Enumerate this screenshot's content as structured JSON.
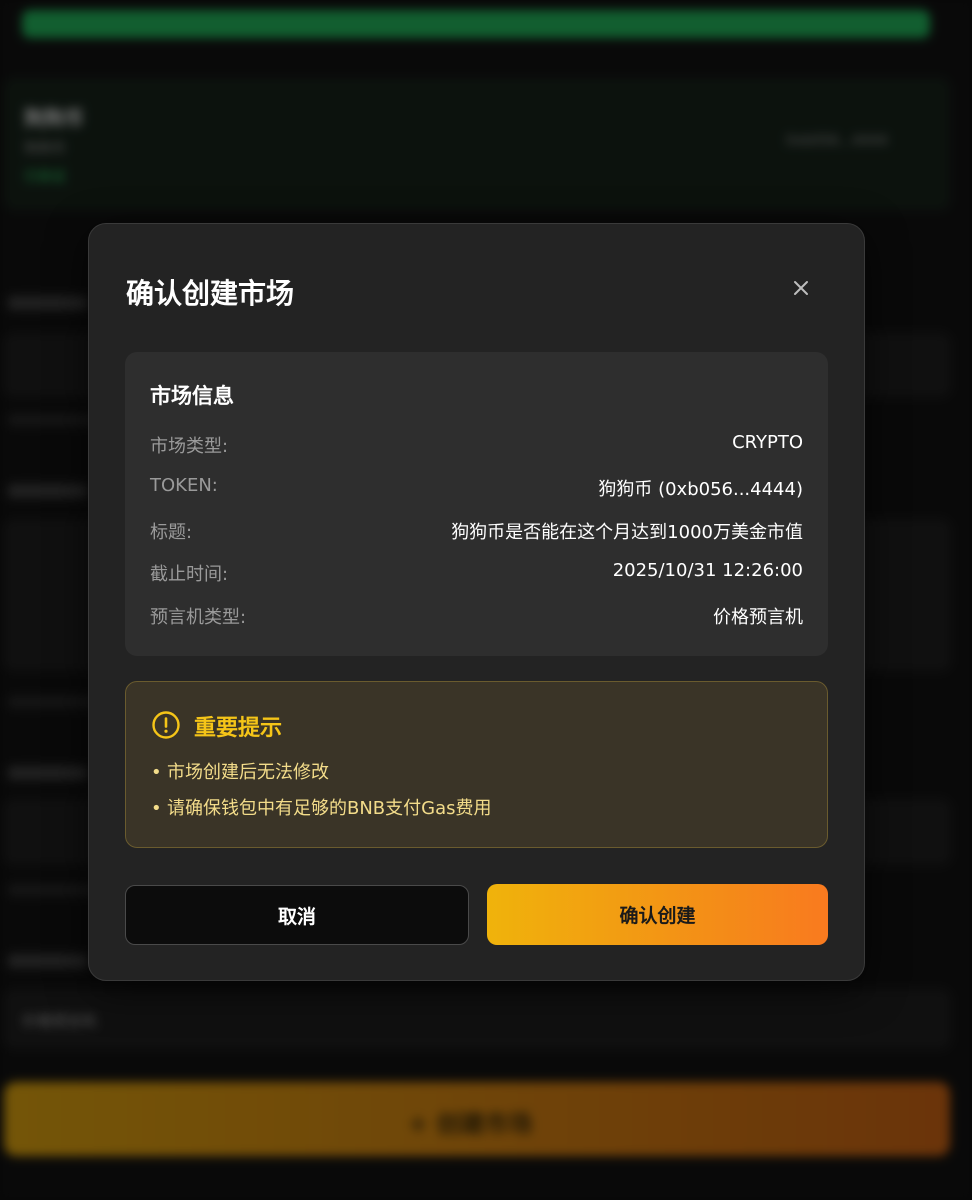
{
  "background": {
    "token_name": "狗狗币",
    "token_sub": "狗狗币",
    "token_status": "已验证",
    "token_address": "0xb056...4444",
    "create_button_label": "+ 创建市场",
    "oracle_select_value": "价格预言机"
  },
  "modal": {
    "title": "确认创建市场",
    "info": {
      "heading": "市场信息",
      "rows": [
        {
          "key": "市场类型:",
          "value": "CRYPTO"
        },
        {
          "key": "TOKEN:",
          "value": "狗狗币 (0xb056...4444)"
        },
        {
          "key": "标题:",
          "value": "狗狗币是否能在这个月达到1000万美金市值"
        },
        {
          "key": "截止时间:",
          "value": "2025/10/31 12:26:00"
        },
        {
          "key": "预言机类型:",
          "value": "价格预言机"
        }
      ]
    },
    "warning": {
      "title": "重要提示",
      "items": [
        "市场创建后无法修改",
        "请确保钱包中有足够的BNB支付Gas费用"
      ]
    },
    "buttons": {
      "cancel": "取消",
      "confirm": "确认创建"
    }
  },
  "colors": {
    "accent_yellow": "#f5c518",
    "confirm_gradient_start": "#f0b30b",
    "confirm_gradient_end": "#f97a1f",
    "progress_green": "#1fa353"
  },
  "icons": {
    "close": "close-icon",
    "warning": "alert-circle-icon"
  }
}
